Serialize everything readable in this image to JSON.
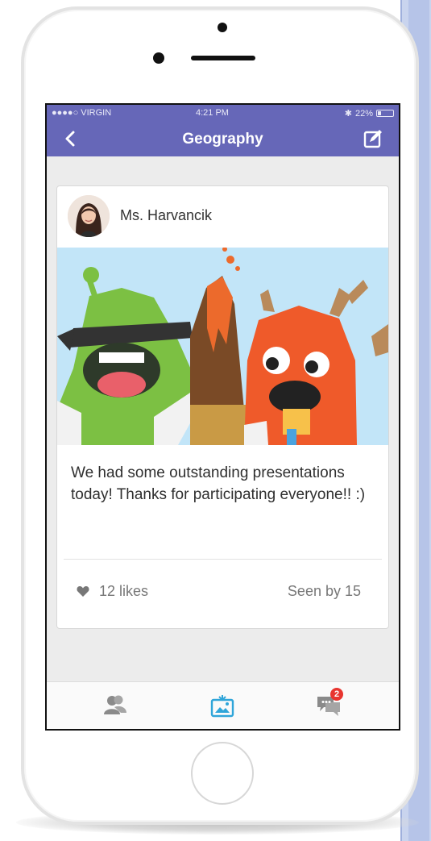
{
  "status_bar": {
    "carrier": "●●●●○ VIRGIN",
    "time": "4:21 PM",
    "battery": "22%",
    "battery_level": 0.22
  },
  "nav": {
    "title": "Geography"
  },
  "post": {
    "author": "Ms. Harvancik",
    "text": "We had some outstanding presentations today! Thanks for participating everyone!! :)",
    "likes": "12 likes",
    "seen_by": "Seen by 15"
  },
  "tabs": {
    "messages_badge": "2"
  },
  "colors": {
    "nav_bar": "#6667b8",
    "active_tab": "#2fa5d9",
    "inactive_tab": "#8a8a8a",
    "badge": "#e8352f"
  },
  "icons": [
    "back-icon",
    "compose-icon",
    "heart-icon",
    "students-icon",
    "story-icon",
    "messages-icon"
  ]
}
